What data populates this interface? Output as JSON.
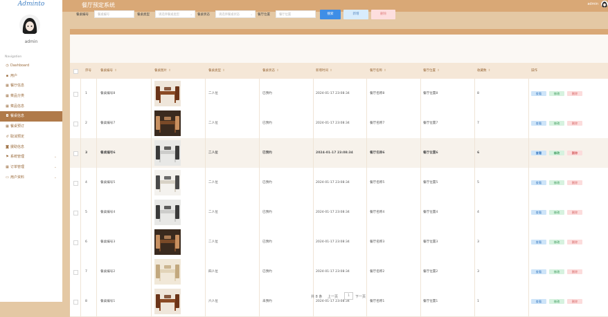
{
  "app": {
    "logo": "Adminto",
    "title": "餐厅预定系统",
    "user": "admin"
  },
  "sidebar": {
    "user": "admin",
    "nav_title": "Navigation",
    "items": [
      {
        "icon": "clock-icon",
        "glyph": "◷",
        "label": "Dashboard",
        "active": false,
        "expandable": false
      },
      {
        "icon": "user-icon",
        "glyph": "▪",
        "label": "用户",
        "active": false,
        "expandable": false
      },
      {
        "icon": "grid-icon",
        "glyph": "▦",
        "label": "餐厅信息",
        "active": false,
        "expandable": false
      },
      {
        "icon": "grid-icon",
        "glyph": "▦",
        "label": "菜品分类",
        "active": false,
        "expandable": false
      },
      {
        "icon": "grid-icon",
        "glyph": "▦",
        "label": "菜品信息",
        "active": false,
        "expandable": false
      },
      {
        "icon": "table-icon",
        "glyph": "◘",
        "label": "餐桌信息",
        "active": true,
        "expandable": false
      },
      {
        "icon": "grid-icon",
        "glyph": "▦",
        "label": "餐桌预订",
        "active": false,
        "expandable": false
      },
      {
        "icon": "return-icon",
        "glyph": "↺",
        "label": "取消预定",
        "active": false,
        "expandable": false
      },
      {
        "icon": "box-icon",
        "glyph": "◙",
        "label": "援助信息",
        "active": false,
        "expandable": false
      },
      {
        "icon": "flag-icon",
        "glyph": "⚑",
        "label": "系统管理",
        "active": false,
        "expandable": true
      },
      {
        "icon": "grid-icon",
        "glyph": "▦",
        "label": "订单管理",
        "active": false,
        "expandable": true
      },
      {
        "icon": "card-icon",
        "glyph": "▭",
        "label": "用户资料",
        "active": false,
        "expandable": true
      }
    ]
  },
  "search": {
    "fields": [
      {
        "label": "餐桌编号",
        "placeholder": "餐桌编号",
        "select": false
      },
      {
        "label": "餐桌类型",
        "placeholder": "请选择餐桌类型",
        "select": true
      },
      {
        "label": "餐桌状态",
        "placeholder": "请选择餐桌状态",
        "select": true
      },
      {
        "label": "餐厅位置",
        "placeholder": "餐厅位置",
        "select": false
      }
    ],
    "search_label": "搜索",
    "add_label": "新增",
    "delete_label": "删除"
  },
  "table": {
    "columns": [
      "序号",
      "餐桌编号",
      "餐桌图片",
      "餐桌类型",
      "餐桌状态",
      "新增时间",
      "餐厅名称",
      "餐厅位置",
      "收藏数",
      "操作"
    ],
    "sortable": [
      false,
      true,
      true,
      true,
      true,
      true,
      true,
      true,
      true,
      false
    ],
    "actions": {
      "view": "查看",
      "edit": "修改",
      "delete": "删除"
    },
    "rows": [
      {
        "no": "1",
        "code": "餐桌编号8",
        "type": "二人位",
        "status": "已预约",
        "time": "2024-01-17 23:08:34",
        "name": "餐厅名称8",
        "loc": "餐厅位置8",
        "fav": "8",
        "photo": "wood",
        "highlight": false
      },
      {
        "no": "2",
        "code": "餐桌编号7",
        "type": "二人位",
        "status": "已预约",
        "time": "2024-01-17 23:08:34",
        "name": "餐厅名称7",
        "loc": "餐厅位置7",
        "fav": "7",
        "photo": "dark",
        "highlight": false
      },
      {
        "no": "3",
        "code": "餐桌编号6",
        "type": "二人位",
        "status": "已预约",
        "time": "2024-01-17 23:08:34",
        "name": "餐厅名称6",
        "loc": "餐厅位置6",
        "fav": "6",
        "photo": "grey",
        "highlight": true
      },
      {
        "no": "4",
        "code": "餐桌编号5",
        "type": "二人位",
        "status": "已预约",
        "time": "2024-01-17 23:08:34",
        "name": "餐厅名称5",
        "loc": "餐厅位置5",
        "fav": "5",
        "photo": "light",
        "highlight": false
      },
      {
        "no": "5",
        "code": "餐桌编号4",
        "type": "二人位",
        "status": "已预约",
        "time": "2024-01-17 23:08:34",
        "name": "餐厅名称4",
        "loc": "餐厅位置4",
        "fav": "4",
        "photo": "grey",
        "highlight": false
      },
      {
        "no": "6",
        "code": "餐桌编号3",
        "type": "二人位",
        "status": "已预约",
        "time": "2024-01-17 23:08:34",
        "name": "餐厅名称3",
        "loc": "餐厅位置3",
        "fav": "3",
        "photo": "dark",
        "highlight": false
      },
      {
        "no": "7",
        "code": "餐桌编号2",
        "type": "四人位",
        "status": "已预约",
        "time": "2024-01-17 23:08:34",
        "name": "餐厅名称2",
        "loc": "餐厅位置2",
        "fav": "3",
        "photo": "cream",
        "highlight": false
      },
      {
        "no": "8",
        "code": "餐桌编号1",
        "type": "六人位",
        "status": "未预约",
        "time": "2024-01-17 23:08:34",
        "name": "餐厅名称1",
        "loc": "餐厅位置1",
        "fav": "1",
        "photo": "wood",
        "highlight": false
      }
    ]
  },
  "pager": {
    "total": "共 8 条",
    "prev": "上一页",
    "current": "1",
    "next": "下一页"
  },
  "colors": {
    "topbar": "#d9a876",
    "background": "#e4c8a4",
    "active_nav": "#b07a49",
    "search_btn": "#3f8ee6"
  }
}
